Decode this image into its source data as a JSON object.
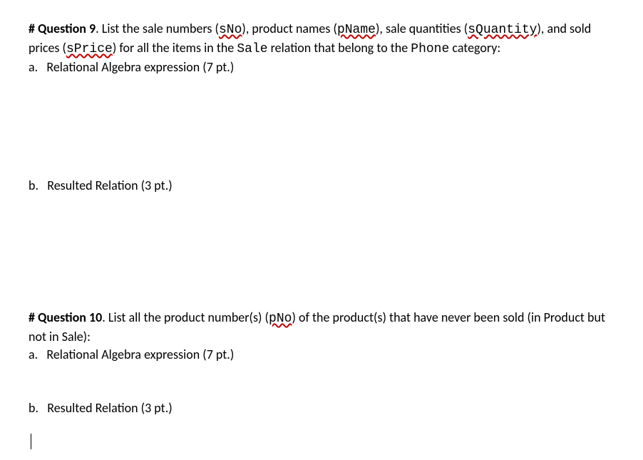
{
  "q9": {
    "header": "# Question 9",
    "text1": ". List the sale numbers (",
    "code1": "sNo",
    "text2": "), product names (",
    "code2": "pName",
    "text3": "), sale quantities (",
    "code3": "sQuantity",
    "text4": "), and sold prices (",
    "code4": "sPrice",
    "text5": ") for all the items in the ",
    "code5": "Sale",
    "text6": " relation that belong to the ",
    "code6": "Phone",
    "text7": " category:",
    "a_label": "a.",
    "a_text": "Relational Algebra expression (7 pt.)",
    "b_label": "b.",
    "b_text": "Resulted Relation (3 pt.)"
  },
  "q10": {
    "header": "# Question 10",
    "text1": ". List all the product number(s) (",
    "code1": "pNo",
    "text2": ") of the product(s) that have never been sold (in Product but not in Sale):",
    "a_label": "a.",
    "a_text": "Relational Algebra expression (7 pt.)",
    "b_label": "b.",
    "b_text": "Resulted Relation (3 pt.)"
  }
}
